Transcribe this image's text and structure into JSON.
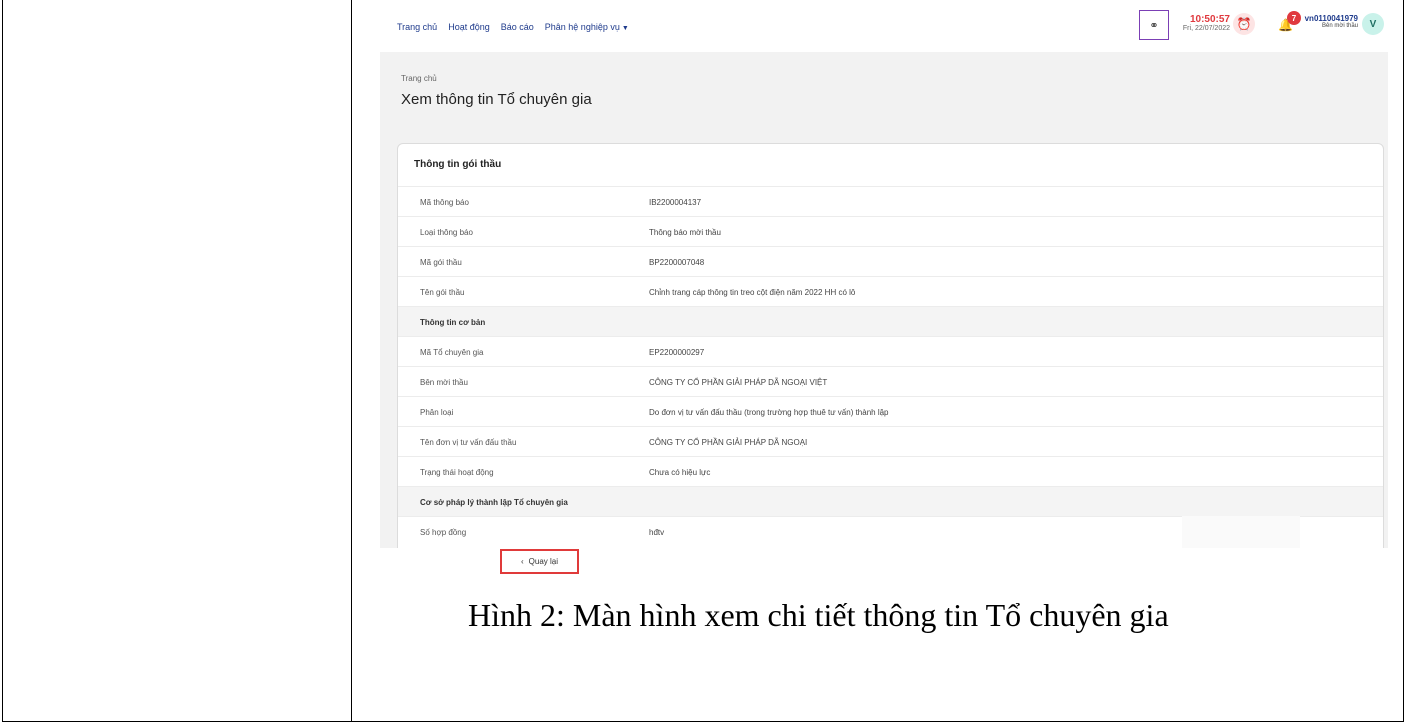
{
  "nav": {
    "items": [
      "Trang chủ",
      "Hoạt động",
      "Báo cáo",
      "Phân hệ nghiệp vụ"
    ],
    "dropdown_caret": "▼"
  },
  "header": {
    "time": "10:50:57",
    "date": "Fri, 22/07/2022",
    "notification_count": "7",
    "username": "vn0110041979",
    "role": "Bên mời thầu",
    "avatar_letter": "V"
  },
  "breadcrumb": "Trang chủ",
  "page_title": "Xem thông tin Tổ chuyên gia",
  "card": {
    "title": "Thông tin gói thầu",
    "rows": [
      {
        "label": "Mã thông báo",
        "value": "IB2200004137"
      },
      {
        "label": "Loại thông báo",
        "value": "Thông báo mời thầu"
      },
      {
        "label": "Mã gói thầu",
        "value": "BP2200007048"
      },
      {
        "label": "Tên gói thầu",
        "value": "Chỉnh trang cáp thông tin treo cột điện năm 2022 HH có lô"
      },
      {
        "label": "Thông tin cơ bản",
        "value": ""
      },
      {
        "label": "Mã Tổ chuyên gia",
        "value": "EP2200000297"
      },
      {
        "label": "Bên mời thầu",
        "value": "CÔNG TY CỔ PHẦN GIẢI PHÁP DÃ NGOẠI VIỆT"
      },
      {
        "label": "Phân loại",
        "value": "Do đơn vị tư vấn đấu thầu (trong trường hợp thuê tư vấn) thành lập"
      },
      {
        "label": "Tên đơn vị tư vấn đấu thầu",
        "value": "CÔNG TY CỔ PHẦN GIẢI PHÁP DÃ NGOẠI"
      },
      {
        "label": "Trạng thái hoạt động",
        "value": "Chưa có hiệu lực"
      },
      {
        "label": "Cơ sở pháp lý thành lập Tổ chuyên gia",
        "value": ""
      },
      {
        "label": "Số hợp đồng",
        "value": "hđtv"
      }
    ]
  },
  "back_button": {
    "label": "Quay lại",
    "icon": "chevron-left-icon"
  },
  "caption": "Hình 2: Màn hình xem chi tiết thông tin Tổ chuyên gia"
}
